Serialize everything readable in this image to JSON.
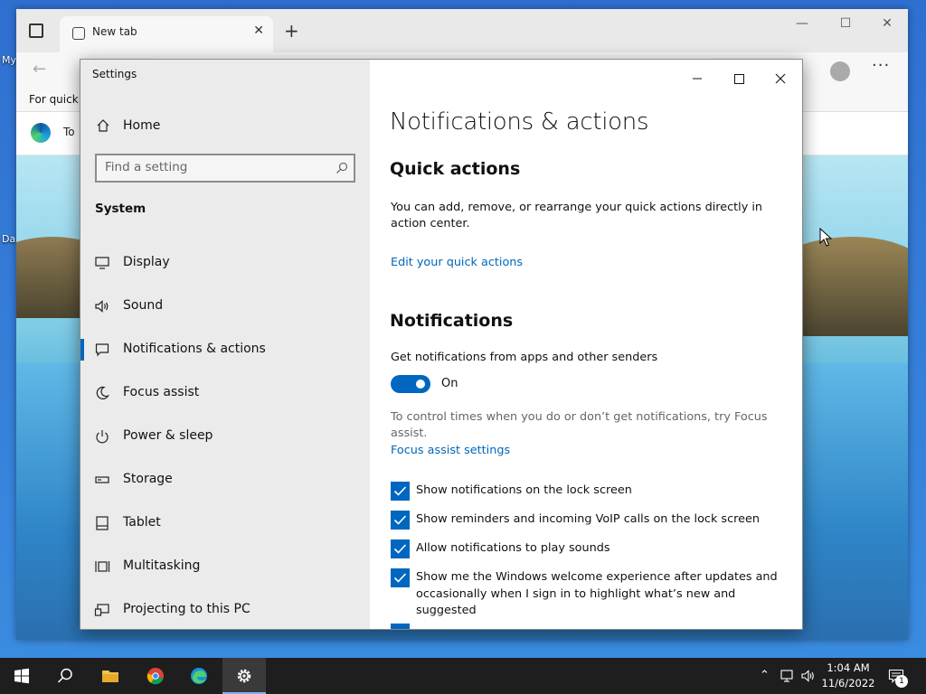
{
  "desktop": {
    "icon_label_1": "My",
    "icon_label_2": "Da"
  },
  "browser": {
    "tab_title": "New tab",
    "favorites_text": "For quick a",
    "content_text": "To"
  },
  "settings": {
    "window_title": "Settings",
    "home_label": "Home",
    "search_placeholder": "Find a setting",
    "section_label": "System",
    "nav_items": [
      {
        "label": "Display",
        "icon": "display-icon"
      },
      {
        "label": "Sound",
        "icon": "sound-icon"
      },
      {
        "label": "Notifications & actions",
        "icon": "notifications-icon",
        "active": true
      },
      {
        "label": "Focus assist",
        "icon": "moon-icon"
      },
      {
        "label": "Power & sleep",
        "icon": "power-icon"
      },
      {
        "label": "Storage",
        "icon": "storage-icon"
      },
      {
        "label": "Tablet",
        "icon": "tablet-icon"
      },
      {
        "label": "Multitasking",
        "icon": "multitasking-icon"
      },
      {
        "label": "Projecting to this PC",
        "icon": "projecting-icon"
      }
    ],
    "page_title": "Notifications & actions",
    "quick_actions_heading": "Quick actions",
    "quick_actions_text": "You can add, remove, or rearrange your quick actions directly in action center.",
    "edit_quick_actions_link": "Edit your quick actions",
    "notifications_heading": "Notifications",
    "get_notifications_label": "Get notifications from apps and other senders",
    "toggle_state": "On",
    "focus_hint": "To control times when you do or don’t get notifications, try Focus assist.",
    "focus_link": "Focus assist settings",
    "checkboxes": [
      {
        "label": "Show notifications on the lock screen",
        "checked": true
      },
      {
        "label": "Show reminders and incoming VoIP calls on the lock screen",
        "checked": true
      },
      {
        "label": "Allow notifications to play sounds",
        "checked": true
      },
      {
        "label": "Show me the Windows welcome experience after updates and occasionally when I sign in to highlight what’s new and suggested",
        "checked": true
      }
    ]
  },
  "taskbar": {
    "time": "1:04 AM",
    "date": "11/6/2022",
    "notification_count": "1"
  },
  "colors": {
    "accent": "#0067c0",
    "link": "#0067b8"
  }
}
